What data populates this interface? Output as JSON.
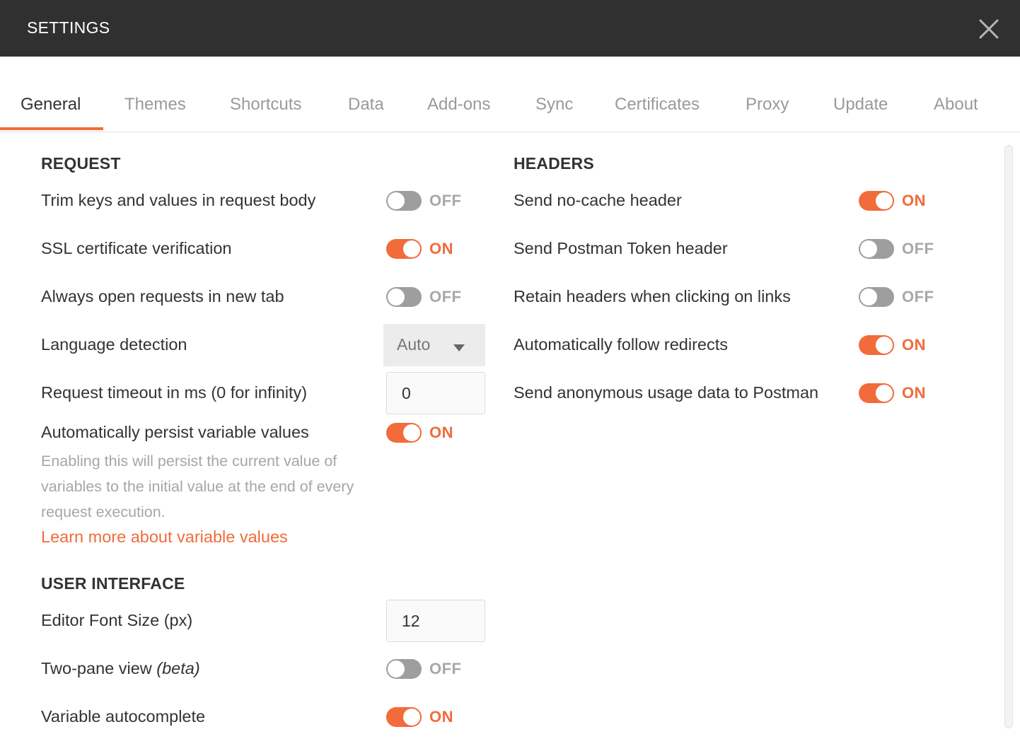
{
  "window": {
    "title": "SETTINGS",
    "close_icon": "close-icon"
  },
  "tabs": [
    {
      "label": "General",
      "active": true
    },
    {
      "label": "Themes"
    },
    {
      "label": "Shortcuts"
    },
    {
      "label": "Data"
    },
    {
      "label": "Add-ons"
    },
    {
      "label": "Sync"
    },
    {
      "label": "Certificates"
    },
    {
      "label": "Proxy"
    },
    {
      "label": "Update"
    },
    {
      "label": "About"
    }
  ],
  "request": {
    "title": "REQUEST",
    "trim_keys": {
      "label": "Trim keys and values in request body",
      "state": "OFF"
    },
    "ssl_verification": {
      "label": "SSL certificate verification",
      "state": "ON"
    },
    "open_new_tab": {
      "label": "Always open requests in new tab",
      "state": "OFF"
    },
    "language_detection": {
      "label": "Language detection",
      "value": "Auto"
    },
    "timeout": {
      "label": "Request timeout in ms (0 for infinity)",
      "value": "0"
    },
    "persist_variables": {
      "label": "Automatically persist variable values",
      "state": "ON",
      "help": "Enabling this will persist the current value of variables to the initial value at the end of every request execution.",
      "link": "Learn more about variable values"
    }
  },
  "user_interface": {
    "title": "USER INTERFACE",
    "font_size": {
      "label": "Editor Font Size (px)",
      "value": "12"
    },
    "two_pane": {
      "label": "Two-pane view",
      "label_suffix": "(beta)",
      "state": "OFF"
    },
    "autocomplete": {
      "label": "Variable autocomplete",
      "state": "ON"
    }
  },
  "headers": {
    "title": "HEADERS",
    "no_cache": {
      "label": "Send no-cache header",
      "state": "ON"
    },
    "postman_token": {
      "label": "Send Postman Token header",
      "state": "OFF"
    },
    "retain_headers": {
      "label": "Retain headers when clicking on links",
      "state": "OFF"
    },
    "follow_redirects": {
      "label": "Automatically follow redirects",
      "state": "ON"
    },
    "usage_data": {
      "label": "Send anonymous usage data to Postman",
      "state": "ON"
    }
  },
  "colors": {
    "accent": "#f26b3a",
    "titlebar": "#303030",
    "toggle_off": "#9e9e9e"
  }
}
